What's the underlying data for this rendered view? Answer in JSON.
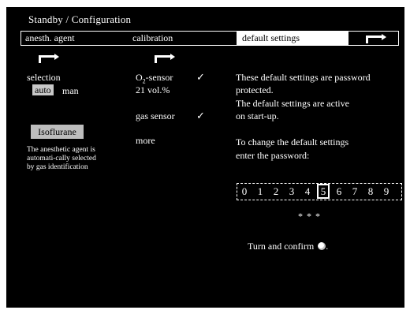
{
  "window": {
    "title": "Standby / Configuration"
  },
  "tabs": [
    {
      "label": "anesth. agent",
      "active": false
    },
    {
      "label": "calibration",
      "active": false
    },
    {
      "label": "default settings",
      "active": true
    }
  ],
  "agent": {
    "selection_label": "selection",
    "mode_selected": "auto",
    "mode_other": "man",
    "agent_name": "Isoflurane",
    "note": "The anesthetic agent is automati-cally selected by gas identification"
  },
  "calibration": {
    "o2_label_main": "O",
    "o2_label_sub": "2",
    "o2_label_rest": "-sensor",
    "o2_check": "✓",
    "o2_value": "21 vol.%",
    "gas_label": "gas sensor",
    "gas_check": "✓",
    "more_label": "more"
  },
  "defaults": {
    "info_line1": "These default settings are password",
    "info_line2": "protected.",
    "info_line3": "The default settings are active",
    "info_line4": "on start-up.",
    "change_line1": "To change the default settings",
    "change_line2": "enter the password:",
    "digits": [
      "0",
      "1",
      "2",
      "3",
      "4",
      "5",
      "6",
      "7",
      "8",
      "9"
    ],
    "selected_digit": "5",
    "entered_mask": "* * *",
    "confirm_text": "Turn and confirm",
    "confirm_suffix": "."
  },
  "colors": {
    "background": "#000000",
    "foreground": "#ffffff",
    "highlight": "#c8c8c8"
  },
  "icons": [
    "arrow-right-icon",
    "checkmark-icon",
    "rotary-knob-icon"
  ]
}
